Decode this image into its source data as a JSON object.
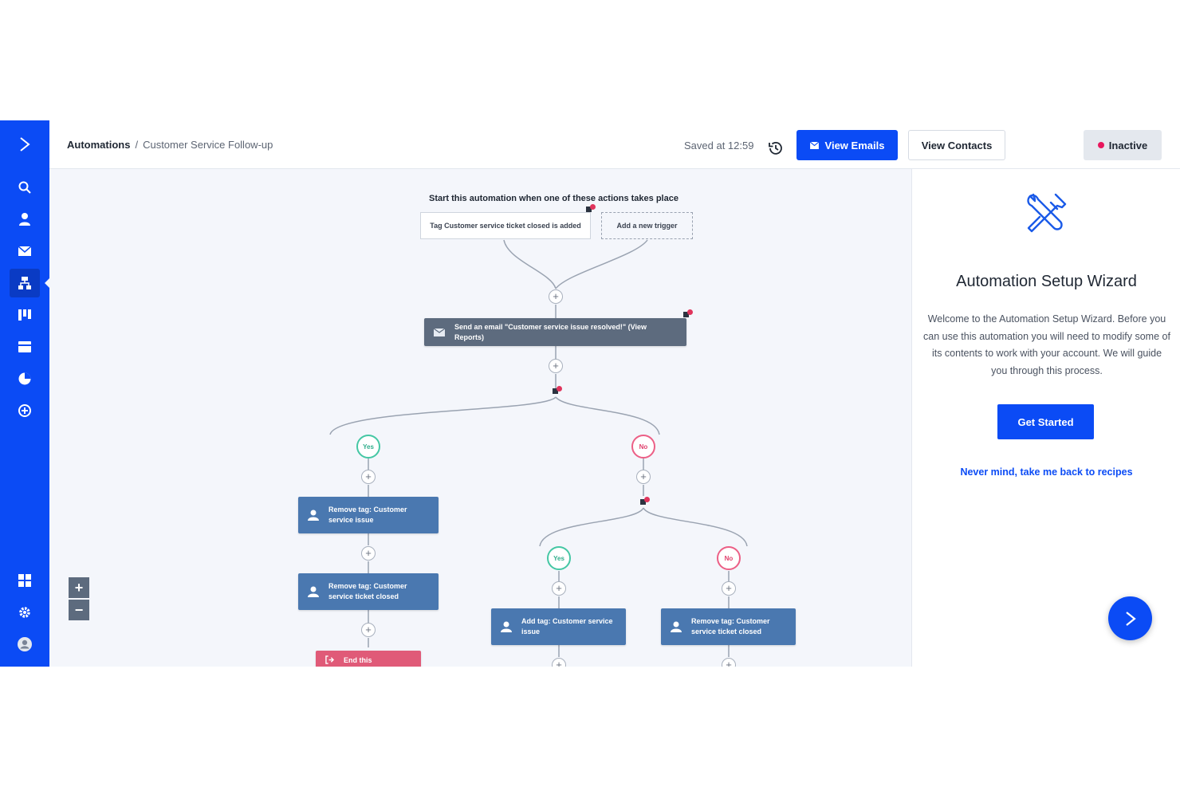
{
  "header": {
    "breadcrumb_root": "Automations",
    "breadcrumb_sep": "/",
    "breadcrumb_current": "Customer Service Follow-up",
    "saved_text": "Saved at 12:59",
    "view_emails_label": "View Emails",
    "view_contacts_label": "View Contacts",
    "status_label": "Inactive"
  },
  "sidebar": {
    "items": [
      {
        "name": "logo",
        "icon": "logo-chevron-icon"
      },
      {
        "name": "search",
        "icon": "search-icon"
      },
      {
        "name": "contacts",
        "icon": "user-icon"
      },
      {
        "name": "campaigns",
        "icon": "envelope-icon"
      },
      {
        "name": "automations",
        "icon": "sitemap-icon",
        "active": true
      },
      {
        "name": "deals",
        "icon": "kanban-icon"
      },
      {
        "name": "lists",
        "icon": "forms-icon"
      },
      {
        "name": "reports",
        "icon": "pie-chart-icon"
      },
      {
        "name": "conversations",
        "icon": "plus-circle-icon"
      },
      {
        "name": "apps",
        "icon": "grid-icon"
      },
      {
        "name": "settings",
        "icon": "gear-icon"
      },
      {
        "name": "account",
        "icon": "avatar-icon"
      }
    ]
  },
  "workflow": {
    "trigger_heading": "Start this automation when one of these actions takes place",
    "trigger_1": "Tag Customer service ticket closed is added",
    "trigger_add": "Add a new trigger",
    "send_email": "Send an email \"Customer service issue resolved!\" (View Reports)",
    "yes_label": "Yes",
    "no_label": "No",
    "yes_action_1": "Remove tag: Customer service issue",
    "yes_action_2": "Remove tag: Customer service ticket closed",
    "end_label": "End this automation",
    "no_yes_action": "Add tag: Customer service issue",
    "no_no_action": "Remove tag: Customer service ticket closed",
    "zoom_in": "+",
    "zoom_out": "−"
  },
  "wizard": {
    "title": "Automation Setup Wizard",
    "description": "Welcome to the Automation Setup Wizard. Before you can use this automation you will need to modify some of its contents to work with your account. We will guide you through this process.",
    "get_started_label": "Get Started",
    "back_link": "Never mind, take me back to recipes"
  },
  "colors": {
    "brand_blue": "#0b4bf5",
    "action_blue": "#4a78b0",
    "action_gray": "#5d6b7e",
    "end_pink": "#e05a78",
    "yes_green": "#45c7a4",
    "no_red": "#ec5f86"
  }
}
